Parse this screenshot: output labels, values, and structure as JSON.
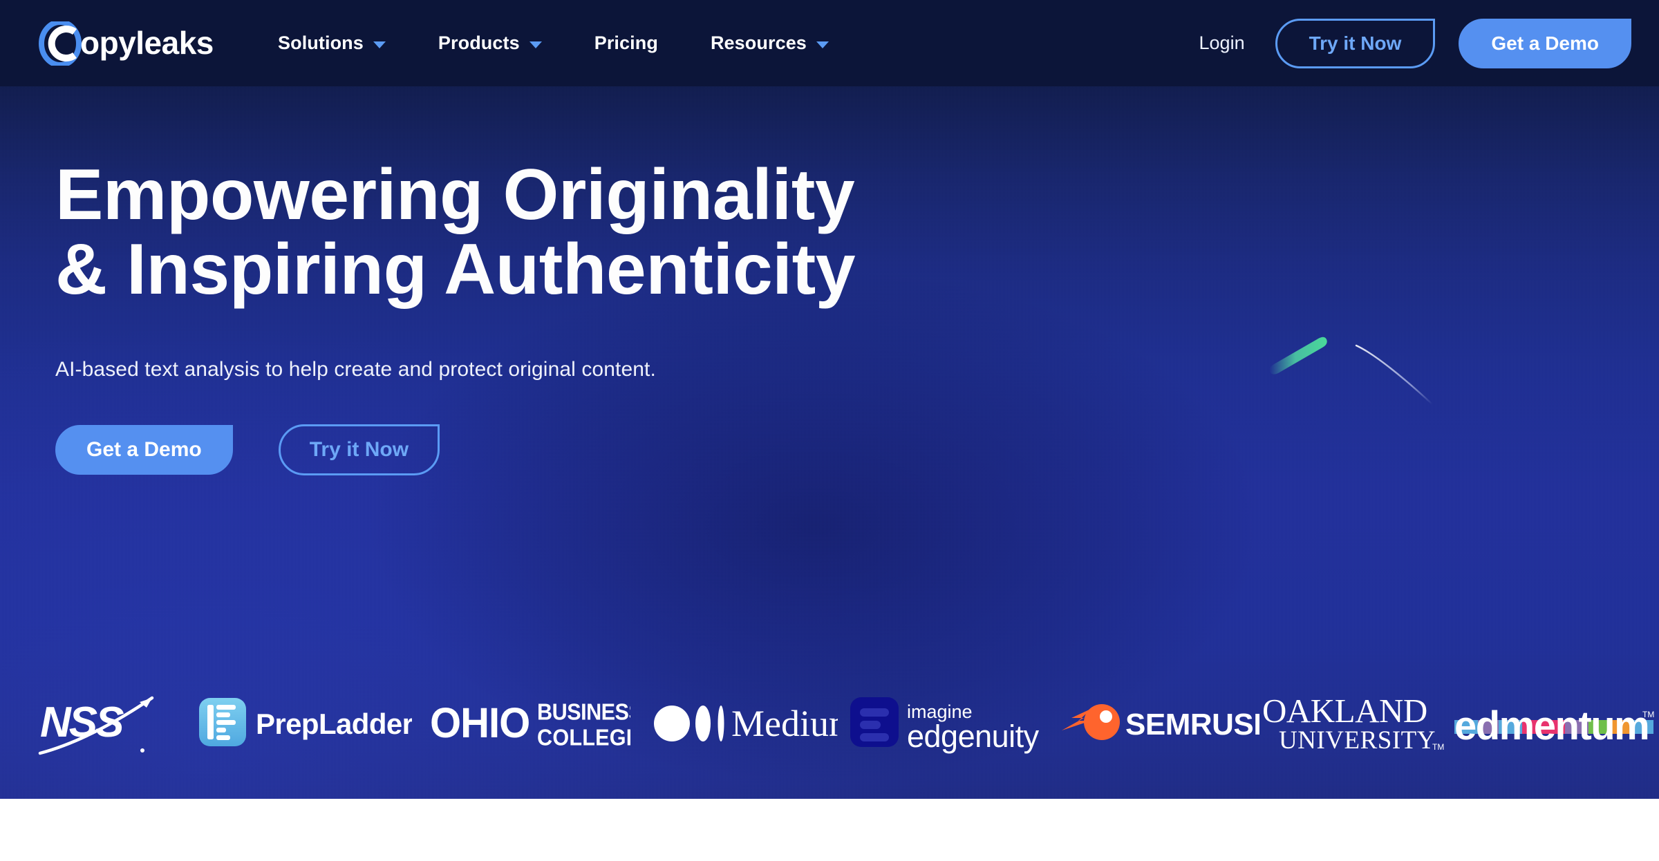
{
  "brand": {
    "name": "Copyleaks",
    "logo_icon": "copyleaks-c-ring-logo"
  },
  "nav": {
    "items": [
      {
        "label": "Solutions",
        "has_dropdown": true,
        "icon": "chevron-down-icon"
      },
      {
        "label": "Products",
        "has_dropdown": true,
        "icon": "chevron-down-icon"
      },
      {
        "label": "Pricing",
        "has_dropdown": false,
        "icon": ""
      },
      {
        "label": "Resources",
        "has_dropdown": true,
        "icon": "chevron-down-icon"
      }
    ],
    "login_label": "Login",
    "try_label": "Try it Now",
    "demo_label": "Get a Demo"
  },
  "hero": {
    "title": "Empowering Originality\n& Inspiring Authenticity",
    "title_line1": "Empowering Originality",
    "title_line2": "& Inspiring Authenticity",
    "subtitle": "AI-based text analysis to help create and protect original content.",
    "primary_cta": "Get a Demo",
    "secondary_cta": "Try it Now"
  },
  "logo_strip": {
    "brands": [
      {
        "name": "NSS",
        "text": "NSS",
        "icon": "nss-swoosh-logo"
      },
      {
        "name": "PrepLadder",
        "text": "PrepLadder",
        "icon": "prepladder-p-icon"
      },
      {
        "name": "Ohio Business College",
        "text": "OHIO BUSINESS COLLEGE",
        "icon": "ohio-business-college-wordmark"
      },
      {
        "name": "Medium",
        "text": "Medium",
        "icon": "medium-dots-logo"
      },
      {
        "name": "Imagine Edgenuity",
        "text": "imagine edgenuity",
        "icon": "edgenuity-bars-icon"
      },
      {
        "name": "Semrush",
        "text": "SEMRUSH",
        "icon": "semrush-comet-icon"
      },
      {
        "name": "Oakland University",
        "text": "OAKLAND UNIVERSITY",
        "icon": "oakland-university-wordmark"
      },
      {
        "name": "Edmentum",
        "text": "edmentum",
        "icon": "edmentum-color-band-logo"
      }
    ]
  },
  "decor": [
    {
      "name": "green-comet-streak",
      "color": "#4ad99a"
    },
    {
      "name": "white-arc-line",
      "color": "#dfe7ff"
    }
  ],
  "colors": {
    "nav_bg": "#0c1539",
    "hero_top": "#0e1a45",
    "hero_bottom": "#21309a",
    "accent_blue": "#5590f0",
    "outline_blue": "#5b9bf4",
    "text_white": "#ffffff",
    "semrush_orange": "#ff642d",
    "prepladder_blue": "#6cc4ec",
    "page_bg": "#ffffff"
  }
}
